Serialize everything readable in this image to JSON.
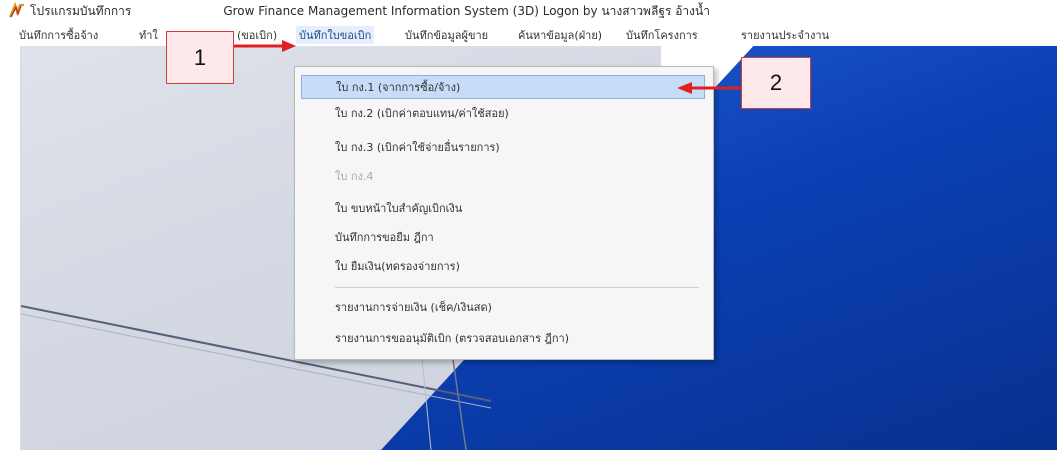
{
  "window": {
    "title_prefix": "โปรแกรมบันทึกการ",
    "title_main": "Grow Finance Management Information System (3D) Logon by นางสาวพลีฐร อ้างน้ำ"
  },
  "menubar": {
    "items": [
      {
        "label": "บันทึกการซื้อจ้าง"
      },
      {
        "label": "ทำใ"
      },
      {
        "label": "(ขอเบิก)"
      },
      {
        "label": "บันทึกใบขอเบิก"
      },
      {
        "label": "บันทึกข้อมูลผู้ขาย"
      },
      {
        "label": "ค้นหาข้อมูล(ฝ่าย)"
      },
      {
        "label": "บันทึกโครงการ"
      },
      {
        "label": "รายงานประจำงาน"
      }
    ]
  },
  "dropdown": {
    "items": [
      {
        "label": "ใบ กง.1 (จากการซื้อ/จ้าง)",
        "state": "highlighted"
      },
      {
        "label": "ใบ กง.2 (เบิกค่าตอบแทน/ค่าใช้สอย)",
        "state": "normal"
      },
      {
        "label": "ใบ กง.3 (เบิกค่าใช้จ่ายอื่นรายการ)",
        "state": "normal"
      },
      {
        "label": "ใบ กง.4",
        "state": "disabled"
      },
      {
        "label": "ใบ ขบหน้าใบสำคัญเบิกเงิน",
        "state": "normal"
      },
      {
        "label": "บันทึกการขอยืม ฎีกา",
        "state": "normal"
      },
      {
        "label": "ใบ ยืมเงิน(ทดรองจ่ายการ)",
        "state": "normal"
      },
      {
        "label": "รายงานการจ่ายเงิน (เช็ค/เงินสด)",
        "state": "normal"
      },
      {
        "label": "รายงานการขออนุมัติเบิก (ตรวจสอบเอกสาร ฎีกา)",
        "state": "normal"
      }
    ]
  },
  "callouts": {
    "one": "1",
    "two": "2"
  },
  "colors": {
    "callout_border": "#d43c3c",
    "arrow": "#e02020",
    "highlight": "#c6dcf7",
    "desktop_blue": "#0b3fb3"
  }
}
